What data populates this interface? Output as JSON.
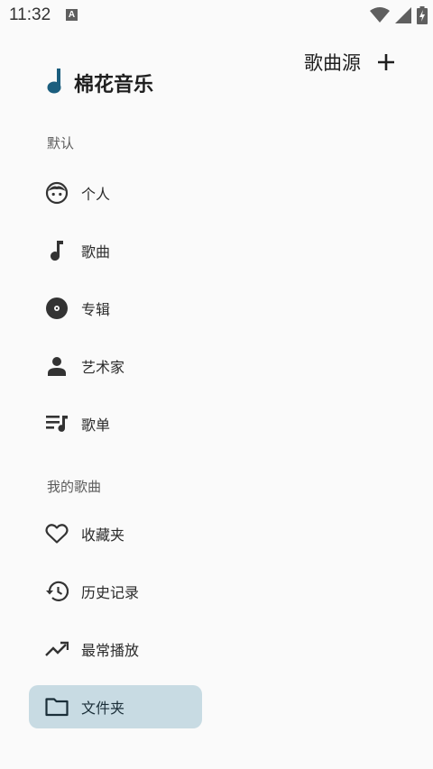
{
  "status_bar": {
    "time": "11:32",
    "notification_glyph": "A",
    "icons": [
      "wifi-icon",
      "signal-icon",
      "battery-charging-icon"
    ]
  },
  "header": {
    "source_label": "歌曲源",
    "add_icon": "plus-icon"
  },
  "app": {
    "title": "棉花音乐",
    "logo_icon": "music-note-icon",
    "accent_color": "#1b5e7e"
  },
  "sections": {
    "default_label": "默认",
    "my_songs_label": "我的歌曲"
  },
  "nav_default": [
    {
      "label": "个人",
      "icon": "face-icon"
    },
    {
      "label": "歌曲",
      "icon": "music-note-icon"
    },
    {
      "label": "专辑",
      "icon": "album-disc-icon"
    },
    {
      "label": "艺术家",
      "icon": "person-icon"
    },
    {
      "label": "歌单",
      "icon": "playlist-icon"
    }
  ],
  "nav_my_songs": [
    {
      "label": "收藏夹",
      "icon": "heart-icon"
    },
    {
      "label": "历史记录",
      "icon": "history-icon"
    },
    {
      "label": "最常播放",
      "icon": "trending-up-icon"
    },
    {
      "label": "文件夹",
      "icon": "folder-icon",
      "selected": true
    }
  ],
  "colors": {
    "selected_bg": "#c8dbe3",
    "background": "#fafafa"
  }
}
